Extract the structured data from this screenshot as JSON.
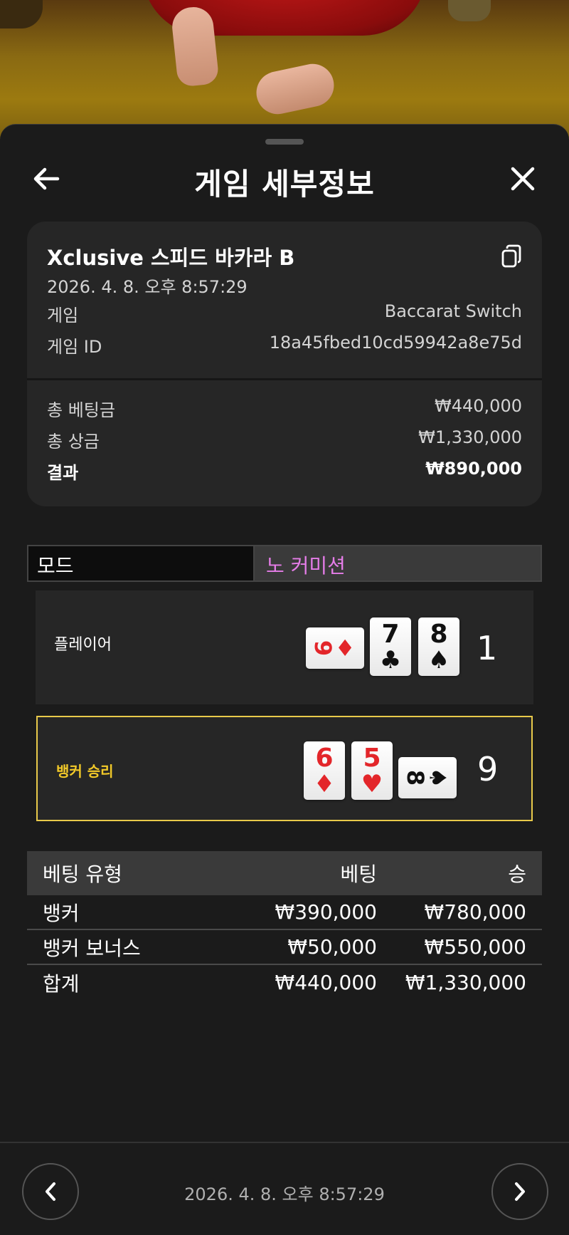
{
  "header": {
    "title": "게임 세부정보"
  },
  "info": {
    "table_name": "Xclusive 스피드 바카라 B",
    "date": "2026. 4. 8. 오후 8:57:29",
    "game_label": "게임",
    "game_value": "Baccarat Switch",
    "game_id_label": "게임 ID",
    "game_id_value": "18a45fbed10cd59942a8e75d",
    "total_bet_label": "총 베팅금",
    "total_bet_value": "₩440,000",
    "total_win_label": "총 상금",
    "total_win_value": "₩1,330,000",
    "result_label": "결과",
    "result_value": "₩890,000"
  },
  "mode": {
    "label": "모드",
    "value": "노 커미션"
  },
  "player": {
    "label": "플레이어",
    "score": "1",
    "cards": [
      {
        "rank": "9",
        "suit": "♦",
        "color": "red",
        "orientation": "horizontal"
      },
      {
        "rank": "7",
        "suit": "♣",
        "color": "black",
        "orientation": "vertical"
      },
      {
        "rank": "8",
        "suit": "♠",
        "color": "black",
        "orientation": "vertical"
      }
    ]
  },
  "banker": {
    "label": "뱅커 승리",
    "score": "9",
    "cards": [
      {
        "rank": "6",
        "suit": "♦",
        "color": "red",
        "orientation": "vertical"
      },
      {
        "rank": "5",
        "suit": "♥",
        "color": "red",
        "orientation": "vertical"
      },
      {
        "rank": "8",
        "suit": "♠",
        "color": "black",
        "orientation": "horizontal"
      }
    ]
  },
  "bets": {
    "headers": {
      "type": "베팅 유형",
      "bet": "베팅",
      "win": "승"
    },
    "rows": [
      {
        "type": "뱅커",
        "bet": "₩390,000",
        "win": "₩780,000"
      },
      {
        "type": "뱅커 보너스",
        "bet": "₩50,000",
        "win": "₩550,000"
      },
      {
        "type": "합계",
        "bet": "₩440,000",
        "win": "₩1,330,000"
      }
    ]
  },
  "footer": {
    "date": "2026. 4. 8. 오후 8:57:29"
  },
  "colors": {
    "accent_pink": "#e57de8",
    "banker_gold": "#f2c929"
  }
}
